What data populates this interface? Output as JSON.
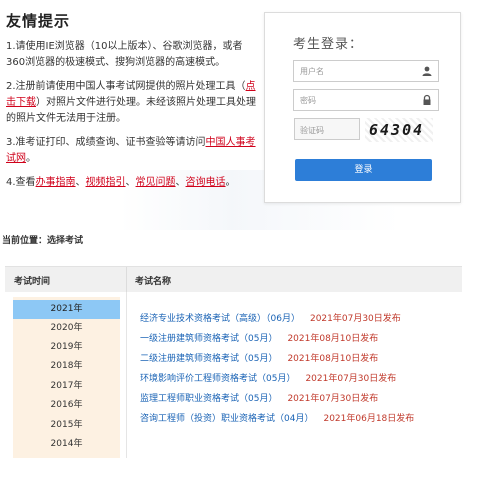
{
  "tips": {
    "title": "友情提示",
    "tip1": "1.请使用IE浏览器（10以上版本）、谷歌浏览器，或者360浏览器的极速模式、搜狗浏览器的高速模式。",
    "tip2_a": "2.注册前请使用中国人事考试网提供的照片处理工具（",
    "tip2_link": "点击下载",
    "tip2_b": "）对照片文件进行处理。未经该照片处理工具处理的照片文件无法用于注册。",
    "tip3_a": "3.准考证打印、成绩查询、证书查验等请访问",
    "tip3_link": "中国人事考试网",
    "tip3_b": "。",
    "tip4_a": "4.查看",
    "tip4_link1": "办事指南",
    "tip4_sep1": "、",
    "tip4_link2": "视频指引",
    "tip4_sep2": "、",
    "tip4_link3": "常见问题",
    "tip4_sep3": "、",
    "tip4_link4": "咨询电话",
    "tip4_b": "。"
  },
  "login": {
    "title": "考生登录：",
    "username_placeholder": "用户名",
    "password_placeholder": "密码",
    "captcha_placeholder": "验证码",
    "captcha_text": "64304",
    "login_button": "登录",
    "user_icon": "user-icon",
    "lock_icon": "lock-icon"
  },
  "breadcrumb": "当前位置：选择考试",
  "table": {
    "col_year": "考试时间",
    "col_name": "考试名称",
    "years": [
      "2021年",
      "2020年",
      "2019年",
      "2018年",
      "2017年",
      "2016年",
      "2015年",
      "2014年"
    ],
    "selected_year": "2021年",
    "exams": [
      {
        "name": "经济专业技术资格考试（高级）（06月）",
        "date": "2021年07月30日发布"
      },
      {
        "name": "一级注册建筑师资格考试（05月）",
        "date": "2021年08月10日发布"
      },
      {
        "name": "二级注册建筑师资格考试（05月）",
        "date": "2021年08月10日发布"
      },
      {
        "name": "环境影响评价工程师资格考试（05月）",
        "date": "2021年07月30日发布"
      },
      {
        "name": "监理工程师职业资格考试（05月）",
        "date": "2021年07月30日发布"
      },
      {
        "name": "咨询工程师（投资）职业资格考试（04月）",
        "date": "2021年06月18日发布"
      }
    ]
  },
  "colors": {
    "accent": "#2d7ed8",
    "link_red": "#d0021b",
    "exam_link": "#1a63b5",
    "year_active": "#8dc8f5",
    "year_bg": "#fdf1e2"
  }
}
